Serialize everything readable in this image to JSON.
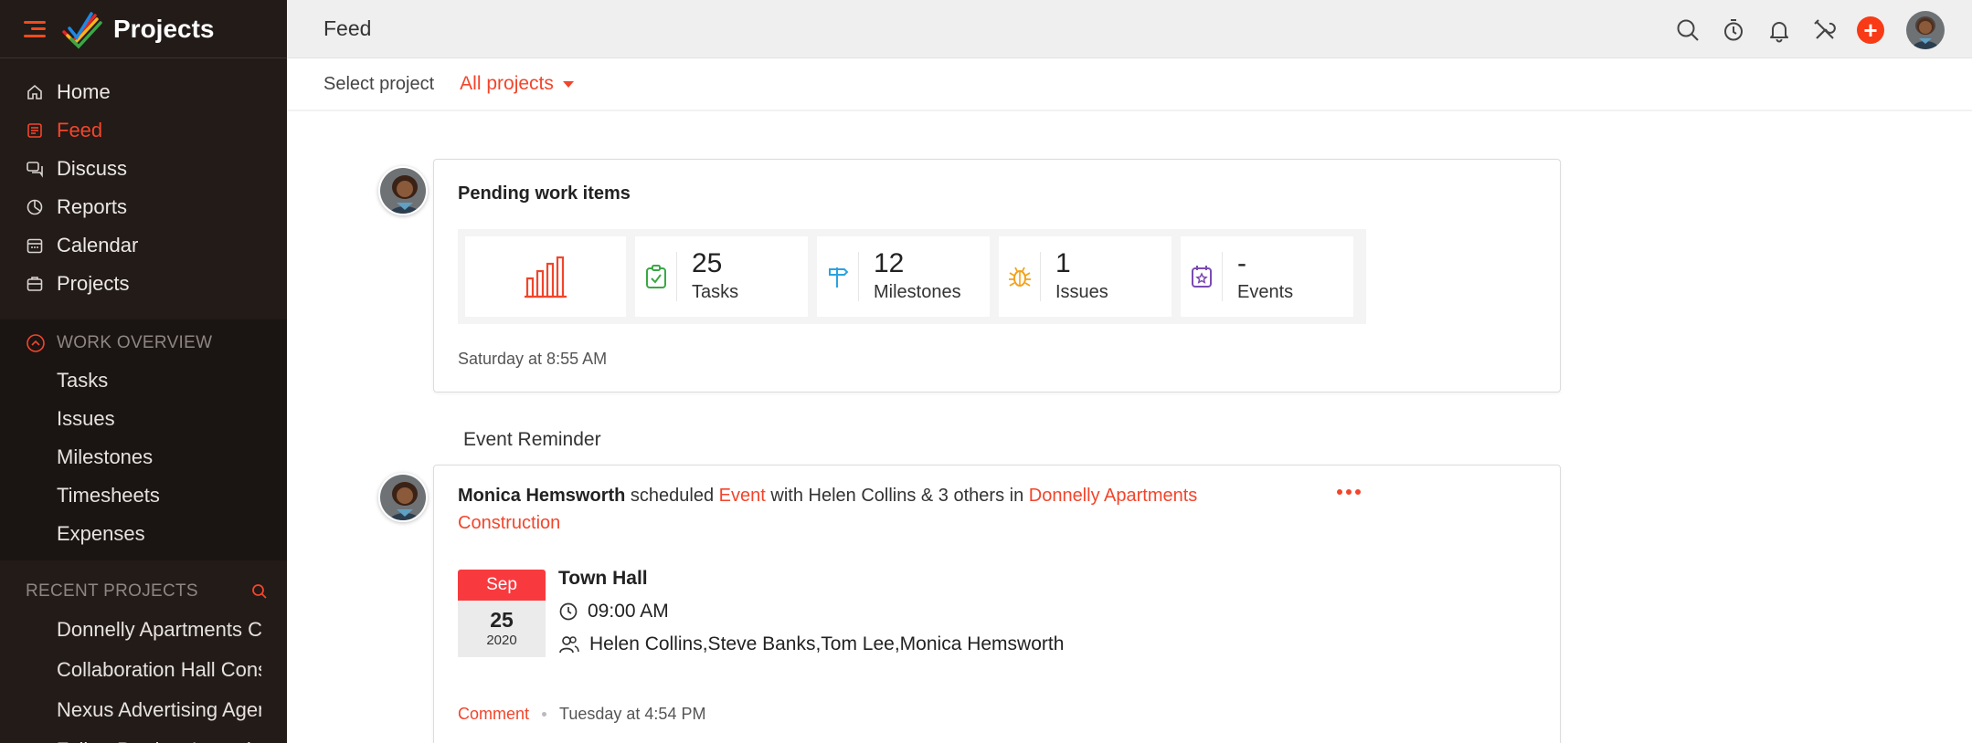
{
  "app": {
    "title": "Projects"
  },
  "sidebar": {
    "nav": [
      {
        "label": "Home",
        "icon": "home-icon"
      },
      {
        "label": "Feed",
        "icon": "feed-icon",
        "active": true
      },
      {
        "label": "Discuss",
        "icon": "discuss-icon"
      },
      {
        "label": "Reports",
        "icon": "reports-icon"
      },
      {
        "label": "Calendar",
        "icon": "calendar-icon"
      },
      {
        "label": "Projects",
        "icon": "projects-icon"
      }
    ],
    "work_overview": {
      "heading": "WORK OVERVIEW",
      "items": [
        "Tasks",
        "Issues",
        "Milestones",
        "Timesheets",
        "Expenses"
      ]
    },
    "recent_projects": {
      "heading": "RECENT PROJECTS",
      "items": [
        "Donnelly Apartments Construction",
        "Collaboration Hall Construction",
        "Nexus Advertising Agency",
        "Zylker Product Launch"
      ]
    }
  },
  "header": {
    "title": "Feed",
    "icons": [
      "search-icon",
      "timer-icon",
      "bell-icon",
      "tools-icon",
      "plus-icon",
      "avatar"
    ],
    "plus": "+"
  },
  "filter": {
    "label": "Select project",
    "value": "All projects"
  },
  "pending": {
    "title": "Pending work items",
    "stats": [
      {
        "value": "25",
        "label": "Tasks",
        "icon": "task-icon"
      },
      {
        "value": "12",
        "label": "Milestones",
        "icon": "milestone-icon"
      },
      {
        "value": "1",
        "label": "Issues",
        "icon": "bug-icon"
      },
      {
        "value": "-",
        "label": "Events",
        "icon": "event-icon"
      }
    ],
    "timestamp": "Saturday at 8:55 AM"
  },
  "event_section_label": "Event Reminder",
  "event": {
    "user": "Monica Hemsworth",
    "verb": "scheduled",
    "type": "Event",
    "with_text": "with Helen Collins & 3 others in",
    "project": "Donnelly Apartments Construction",
    "date": {
      "month": "Sep",
      "day": "25",
      "year": "2020"
    },
    "title": "Town Hall",
    "time": "09:00 AM",
    "attendees": "Helen Collins,Steve Banks,Tom Lee,Monica Hemsworth",
    "comment_label": "Comment",
    "timestamp": "Tuesday at 4:54 PM"
  },
  "colors": {
    "accent": "#f2452b",
    "sidebar_bg": "#221b18",
    "date_red": "#f83a3f"
  }
}
